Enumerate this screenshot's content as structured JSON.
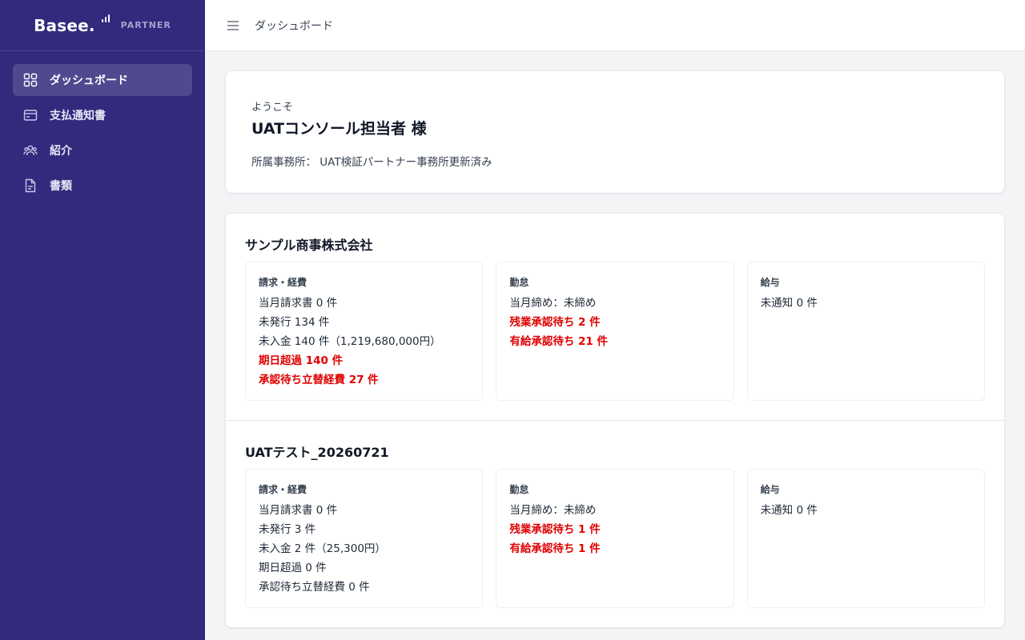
{
  "brand": {
    "name": "Basee.",
    "sub": "PARTNER"
  },
  "sidebar": {
    "items": [
      {
        "label": "ダッシュボード",
        "icon": "grid-icon"
      },
      {
        "label": "支払通知書",
        "icon": "card-icon"
      },
      {
        "label": "紹介",
        "icon": "users-icon"
      },
      {
        "label": "書類",
        "icon": "document-icon"
      }
    ]
  },
  "header": {
    "title": "ダッシュボード"
  },
  "welcome": {
    "greeting": "ようこそ",
    "name": "UATコンソール担当者 様",
    "office": "所属事務所： UAT検証パートナー事務所更新済み"
  },
  "companies": [
    {
      "name": "サンプル商事株式会社",
      "billing": {
        "title": "請求・経費",
        "lines": [
          "当月請求書 0 件",
          "未発行 134 件",
          "未入金 140 件（1,219,680,000円）",
          "期日超過 140 件",
          "承認待ち立替経費 27 件"
        ]
      },
      "attendance": {
        "title": "勤怠",
        "lines": [
          "当月締め：未締め",
          "残業承認待ち 2 件",
          "有給承認待ち 21 件"
        ]
      },
      "payroll": {
        "title": "給与",
        "lines": [
          "未通知 0 件"
        ]
      }
    },
    {
      "name": "UATテスト_20260721",
      "billing": {
        "title": "請求・経費",
        "lines": [
          "当月請求書 0 件",
          "未発行 3 件",
          "未入金 2 件（25,300円）",
          "期日超過 0 件",
          "承認待ち立替経費 0 件"
        ]
      },
      "attendance": {
        "title": "勤怠",
        "lines": [
          "当月締め：未締め",
          "残業承認待ち 1 件",
          "有給承認待ち 1 件"
        ]
      },
      "payroll": {
        "title": "給与",
        "lines": [
          "未通知 0 件"
        ]
      }
    }
  ],
  "colors": {
    "sidebar": "#312a7d",
    "alert": "#e00000",
    "background": "#f3f4f6"
  }
}
